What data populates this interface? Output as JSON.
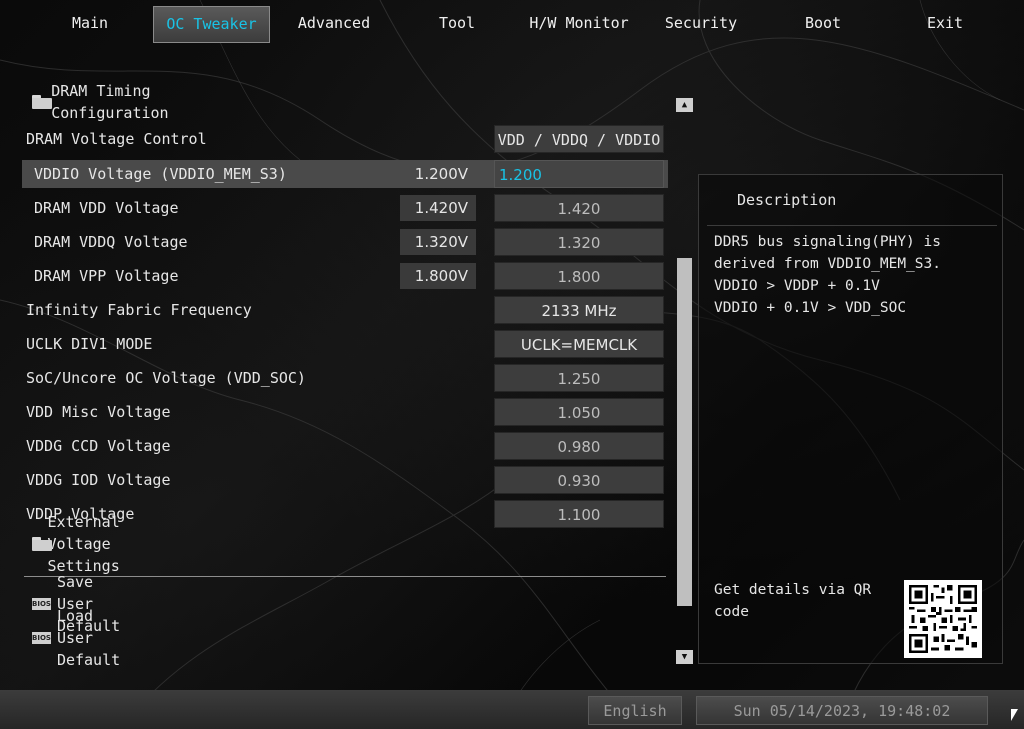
{
  "nav": {
    "tabs": [
      {
        "label": "Main"
      },
      {
        "label": "OC Tweaker"
      },
      {
        "label": "Advanced"
      },
      {
        "label": "Tool"
      },
      {
        "label": "H/W Monitor"
      },
      {
        "label": "Security"
      },
      {
        "label": "Boot"
      },
      {
        "label": "Exit"
      }
    ],
    "active": "OC Tweaker"
  },
  "sections": {
    "dram_timing": "DRAM Timing Configuration",
    "external_voltage": "External Voltage Settings"
  },
  "settings": [
    {
      "label": "DRAM Voltage Control",
      "value": "VDD / VDDQ / VDDIO",
      "readout": ""
    },
    {
      "label": "VDDIO Voltage (VDDIO_MEM_S3)",
      "value": "1.200",
      "readout": "1.200V"
    },
    {
      "label": "DRAM VDD Voltage",
      "value": "1.420",
      "readout": "1.420V"
    },
    {
      "label": "DRAM VDDQ Voltage",
      "value": "1.320",
      "readout": "1.320V"
    },
    {
      "label": "DRAM VPP Voltage",
      "value": "1.800",
      "readout": "1.800V"
    },
    {
      "label": "Infinity Fabric Frequency",
      "value": "2133 MHz",
      "readout": ""
    },
    {
      "label": "UCLK DIV1 MODE",
      "value": "UCLK=MEMCLK",
      "readout": ""
    },
    {
      "label": "SoC/Uncore OC Voltage (VDD_SOC)",
      "value": "1.250",
      "readout": ""
    },
    {
      "label": "VDD Misc Voltage",
      "value": "1.050",
      "readout": ""
    },
    {
      "label": "VDDG CCD Voltage",
      "value": "0.980",
      "readout": ""
    },
    {
      "label": "VDDG IOD Voltage",
      "value": "0.930",
      "readout": ""
    },
    {
      "label": "VDDP Voltage",
      "value": "1.100",
      "readout": ""
    }
  ],
  "bios_actions": {
    "icon_text": "BIOS",
    "save": "Save User Default",
    "load": "Load User Default"
  },
  "description": {
    "title": "Description",
    "body": "DDR5 bus signaling(PHY) is\nderived from VDDIO_MEM_S3.\nVDDIO > VDDP + 0.1V\nVDDIO + 0.1V > VDD_SOC",
    "qr_text": "Get details via QR code"
  },
  "status": {
    "language": "English",
    "datetime": "Sun 05/14/2023, 19:48:02"
  },
  "colors": {
    "accent": "#19c3e6",
    "highlight_row": "#4a4a4a"
  }
}
